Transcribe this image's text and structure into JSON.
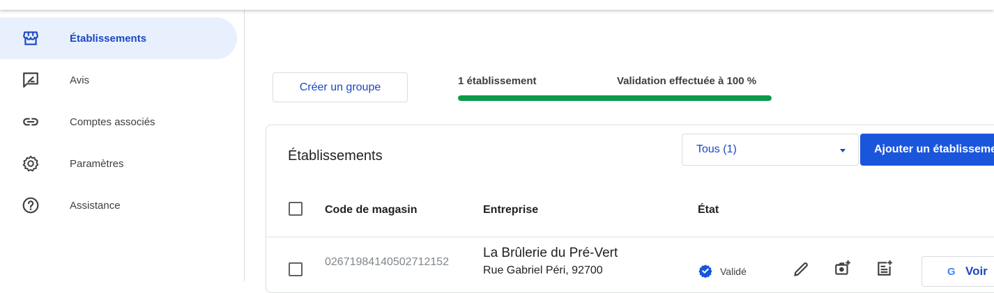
{
  "sidebar": {
    "items": [
      {
        "label": "Établissements",
        "icon": "storefront-icon"
      },
      {
        "label": "Avis",
        "icon": "rate-review-icon"
      },
      {
        "label": "Comptes associés",
        "icon": "link-icon"
      },
      {
        "label": "Paramètres",
        "icon": "gear-icon"
      },
      {
        "label": "Assistance",
        "icon": "help-icon"
      }
    ]
  },
  "toolbar": {
    "create_group_label": "Créer un groupe",
    "count_label": "1 établissement",
    "validation_label": "Validation effectuée à 100 %",
    "validation_progress": 1.0
  },
  "card": {
    "title": "Établissements",
    "filter_value": "Tous (1)",
    "add_button_label": "Ajouter un établissement"
  },
  "table": {
    "headers": [
      "Code de magasin",
      "Entreprise",
      "État"
    ],
    "rows": [
      {
        "store_code": "02671984140502712152",
        "business_name": "La Brûlerie du Pré-Vert",
        "address": "Rue Gabriel Péri, 92700",
        "status": "Validé",
        "view_label": "Voir",
        "google_letter": "G"
      }
    ]
  },
  "colors": {
    "accent": "#1a47c2",
    "primary_button": "#1a56db",
    "progress": "#0b9a4b",
    "active_nav_bg": "#e8f0fe"
  }
}
